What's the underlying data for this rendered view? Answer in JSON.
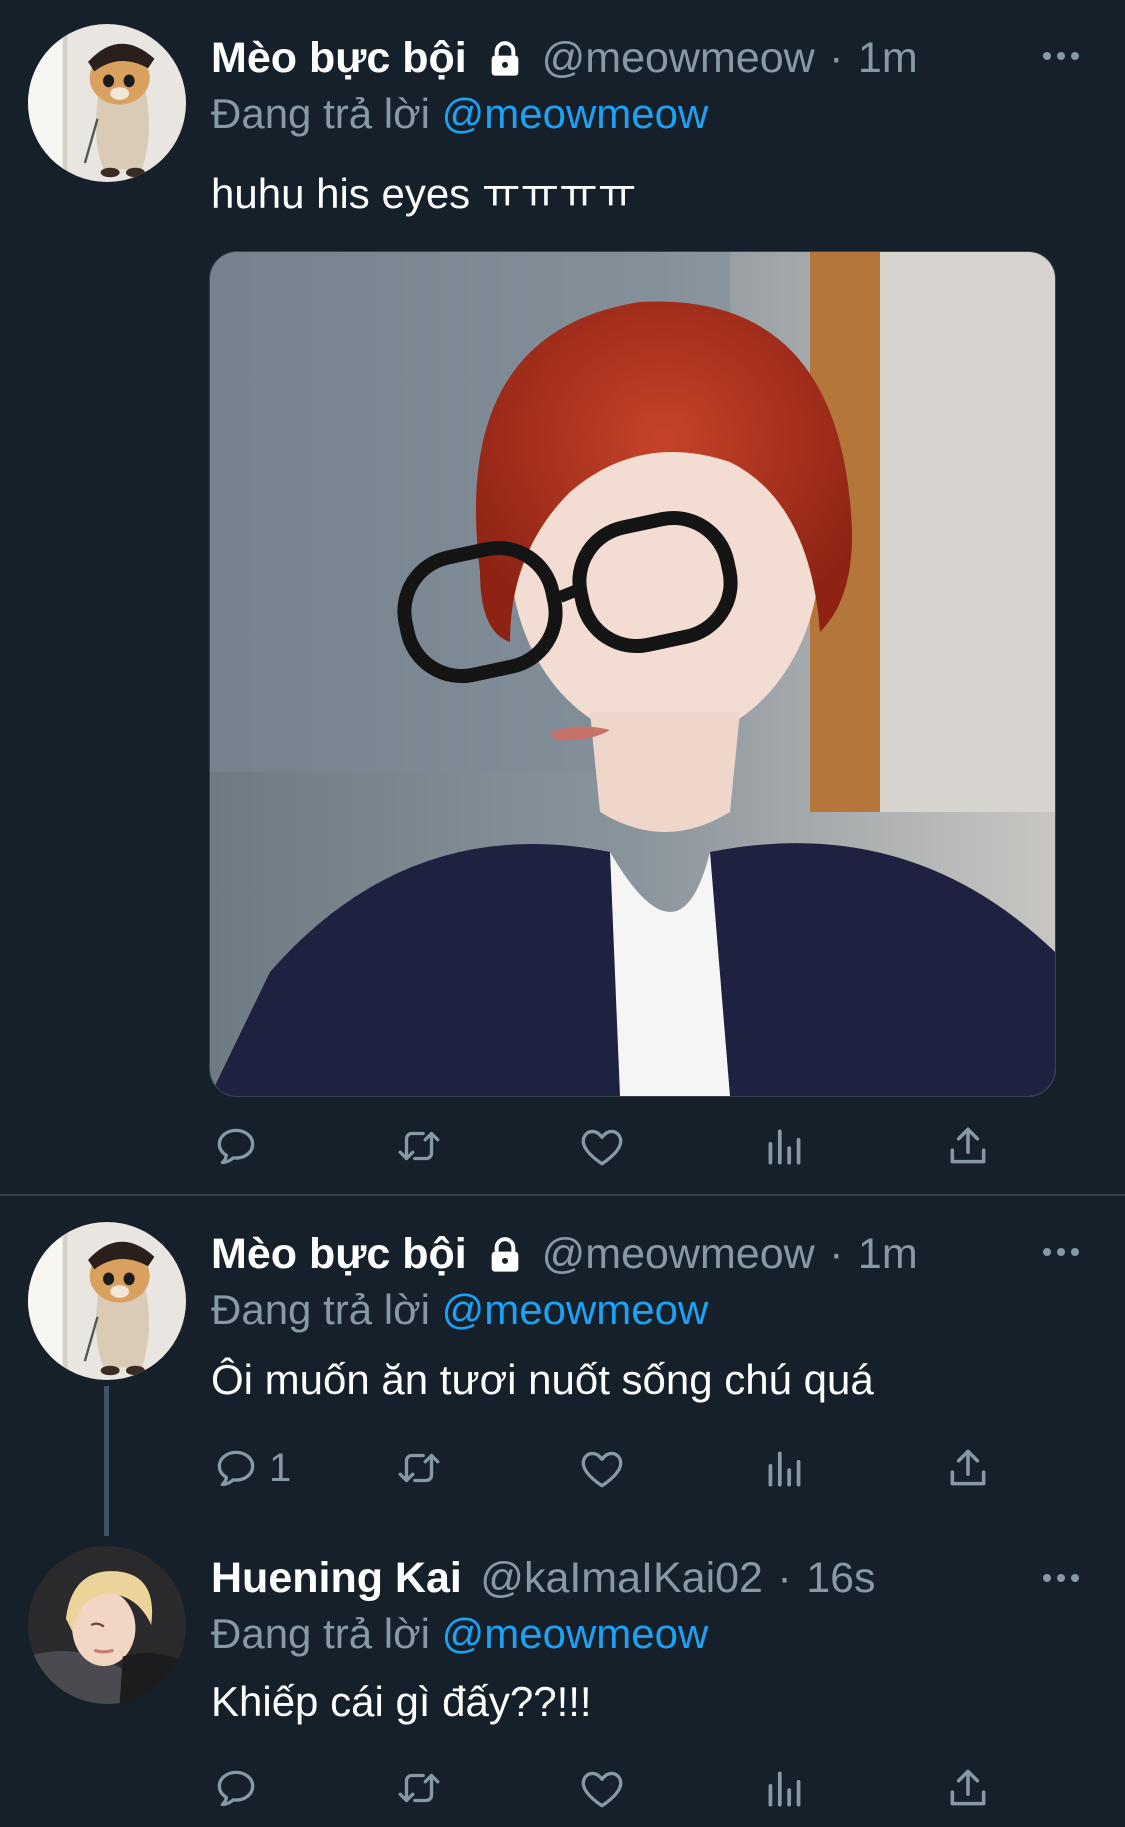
{
  "tweets": [
    {
      "name": "Mèo bực bội",
      "handle": "@meowmeow",
      "dot": "·",
      "time": "1m",
      "reply_prefix": "Đang trả lời ",
      "reply_to": "@meowmeow",
      "text": "huhu his eyes ㅠㅠㅠㅠ",
      "protected": true,
      "has_media": true,
      "actions": {
        "reply_count": "",
        "retweet_count": "",
        "like_count": ""
      }
    },
    {
      "name": "Mèo bực bội",
      "handle": "@meowmeow",
      "dot": "·",
      "time": "1m",
      "reply_prefix": "Đang trả lời ",
      "reply_to": "@meowmeow",
      "text": "Ôi muốn ăn tươi nuốt sống chú quá",
      "protected": true,
      "has_media": false,
      "actions": {
        "reply_count": "1",
        "retweet_count": "",
        "like_count": ""
      }
    },
    {
      "name": "Huening Kai",
      "handle": "@kaImaIKai02",
      "dot": "·",
      "time": "16s",
      "reply_prefix": "Đang trả lời ",
      "reply_to": "@meowmeow",
      "text": "Khiếp cái gì đấy??!!!",
      "protected": false,
      "has_media": false,
      "actions": {
        "reply_count": "",
        "retweet_count": "",
        "like_count": ""
      }
    }
  ],
  "icons": {
    "reply": "reply-icon",
    "retweet": "retweet-icon",
    "like": "heart-icon",
    "analytics": "analytics-icon",
    "share": "share-icon",
    "more": "more-icon",
    "lock": "lock-icon"
  },
  "colors": {
    "background": "#15202b",
    "text_primary": "#ffffff",
    "text_secondary": "#8899a6",
    "accent": "#1da1f2",
    "divider": "#38444d"
  }
}
